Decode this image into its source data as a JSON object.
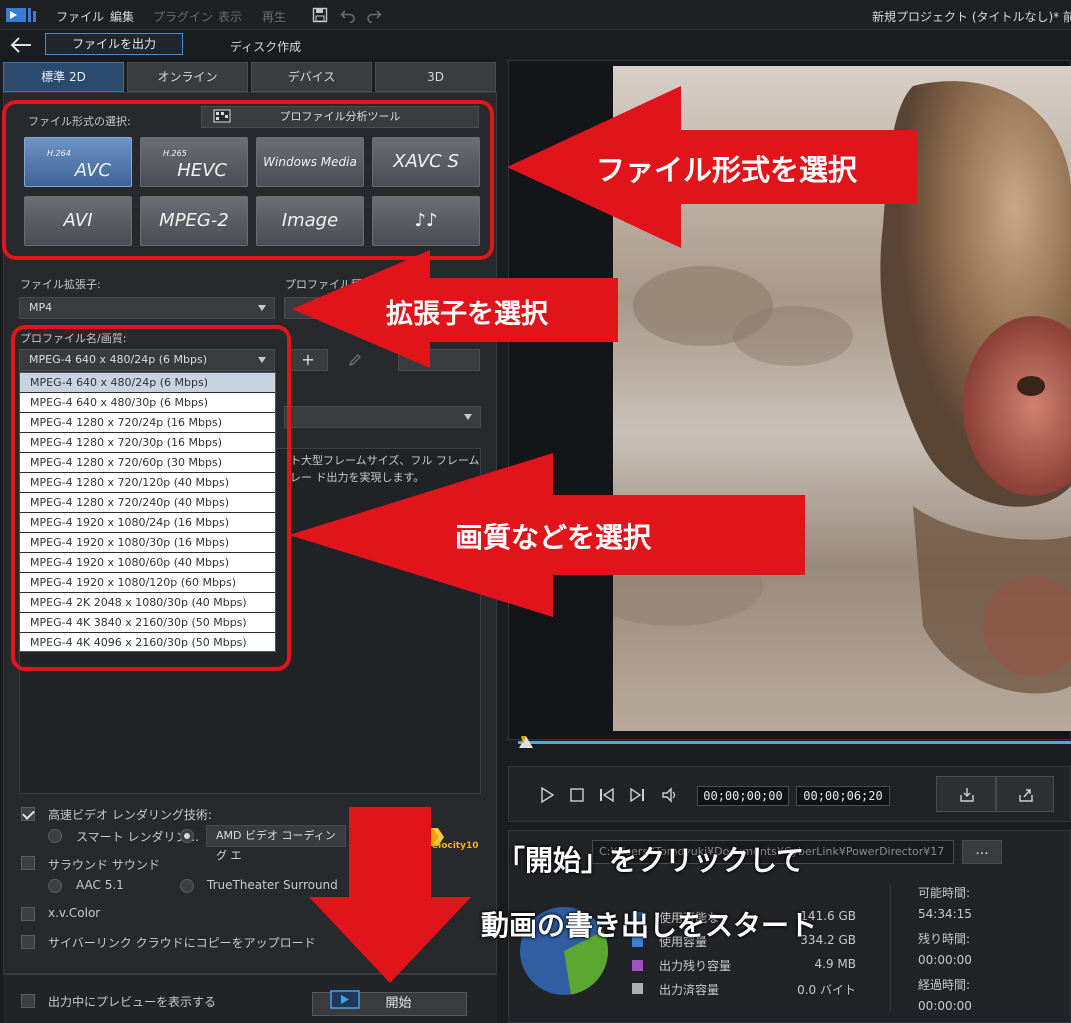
{
  "menubar": {
    "items": [
      {
        "label": "ファイル",
        "enabled": true
      },
      {
        "label": "編集",
        "enabled": true
      },
      {
        "label": "プラグイン",
        "enabled": false
      },
      {
        "label": "表示",
        "enabled": false
      },
      {
        "label": "再生",
        "enabled": false
      }
    ],
    "project_title": "新規プロジェクト (タイトルなし)* 前回保存"
  },
  "subnav": {
    "output_file": "ファイルを出力",
    "disc_create": "ディスク作成"
  },
  "tabs": [
    "標準 2D",
    "オンライン",
    "デバイス",
    "3D"
  ],
  "format": {
    "label": "ファイル形式の選択:",
    "profile_tool": "プロファイル分析ツール",
    "buttons": {
      "avc_sub": "H.264",
      "avc_main": "AVC",
      "hevc_sub": "H.265",
      "hevc_main": "HEVC",
      "wm": "Windows Media",
      "xavc": "XAVC S",
      "avi": "AVI",
      "mpeg2": "MPEG-2",
      "image": "Image",
      "audio": "♪♪"
    }
  },
  "fields": {
    "ext_label": "ファイル拡張子:",
    "ext_value": "MP4",
    "profile_type_label": "プロファイル種類",
    "profile_label": "プロファイル名/画質:",
    "profile_value": "MPEG-4 640 x 480/24p (6 Mbps)",
    "add_icon": "+",
    "description": "ト大型フレームサイズ、フル フレーム レー ド出力を実現します。"
  },
  "profile_list": [
    "MPEG-4 640 x 480/24p (6 Mbps)",
    "MPEG-4 640 x 480/30p (6 Mbps)",
    "MPEG-4 1280 x 720/24p (16 Mbps)",
    "MPEG-4 1280 x 720/30p (16 Mbps)",
    "MPEG-4 1280 x 720/60p (30 Mbps)",
    "MPEG-4 1280 x 720/120p (40 Mbps)",
    "MPEG-4 1280 x 720/240p (40 Mbps)",
    "MPEG-4 1920 x 1080/24p (16 Mbps)",
    "MPEG-4 1920 x 1080/30p (16 Mbps)",
    "MPEG-4 1920 x 1080/60p (40 Mbps)",
    "MPEG-4 1920 x 1080/120p (60 Mbps)",
    "MPEG-4 2K 2048 x 1080/30p (40 Mbps)",
    "MPEG-4 4K 3840 x 2160/30p (50 Mbps)",
    "MPEG-4 4K 4096 x 2160/30p (50 Mbps)"
  ],
  "options": {
    "fast_render": "高速ビデオ レンダリング技術:",
    "smart_render": "スマート レンダリン...",
    "amd_encoding": "AMD ビデオ コーディング エ",
    "velocity": "elocity10",
    "surround": "サラウンド サウンド",
    "aac": "AAC 5.1",
    "truetheater": "TrueTheater Surround",
    "xvcolor": "x.v.Color",
    "cloud_upload": "サイバーリンク クラウドにコピーをアップロード",
    "preview_during": "出力中にプレビューを表示する"
  },
  "start_label": "開始",
  "player": {
    "timecode_current": "00;00;00;00",
    "timecode_total": "00;00;06;20"
  },
  "output_info": {
    "path": "C:¥Users¥Tomoyuki¥Documents¥CyberLink¥PowerDirector¥17",
    "more_label": "...",
    "legend": [
      {
        "label": "使用可能な",
        "value": "141.6 GB",
        "color": "#2f5ea3"
      },
      {
        "label": "使用容量",
        "value": "334.2 GB",
        "color": "#3f7fd6"
      },
      {
        "label": "出力残り容量",
        "value": "4.9 MB",
        "color": "#a24fc0"
      },
      {
        "label": "出力済容量",
        "value": "0.0 バイト",
        "color": "#b0b0b0"
      }
    ],
    "pie": {
      "used_fraction": 0.3
    },
    "times": {
      "available_label": "可能時間:",
      "available_value": "54:34:15",
      "remaining_label": "残り時間:",
      "remaining_value": "00:00:00",
      "elapsed_label": "経過時間:",
      "elapsed_value": "00:00:00"
    }
  },
  "annotations": {
    "file_format": "ファイル形式を選択",
    "extension": "拡張子を選択",
    "quality": "画質などを選択",
    "click_start": "「開始」をクリックして",
    "start_export": "動画の書き出しをスタート"
  },
  "colors": {
    "annotation_red": "#e1141c",
    "accent_blue": "#3d8fd6",
    "timeline": "#4aa8e0"
  }
}
